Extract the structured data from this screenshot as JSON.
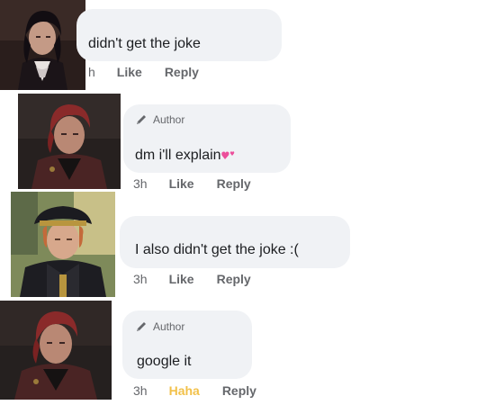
{
  "comments": [
    {
      "text": "didn't get the joke",
      "time": "h",
      "like": "Like",
      "reply": "Reply"
    },
    {
      "author_badge": "Author",
      "text": "dm i'll explain",
      "emoji": "two-hearts-icon",
      "time": "3h",
      "like": "Like",
      "reply": "Reply"
    },
    {
      "text": "I also didn't get the joke :(",
      "time": "3h",
      "like": "Like",
      "reply": "Reply"
    },
    {
      "author_badge": "Author",
      "text": "google it",
      "time": "3h",
      "like": "Haha",
      "reply": "Reply"
    }
  ],
  "colors": {
    "bubble": "#f0f2f5",
    "meta": "#65676b",
    "haha": "#f2c14a"
  }
}
